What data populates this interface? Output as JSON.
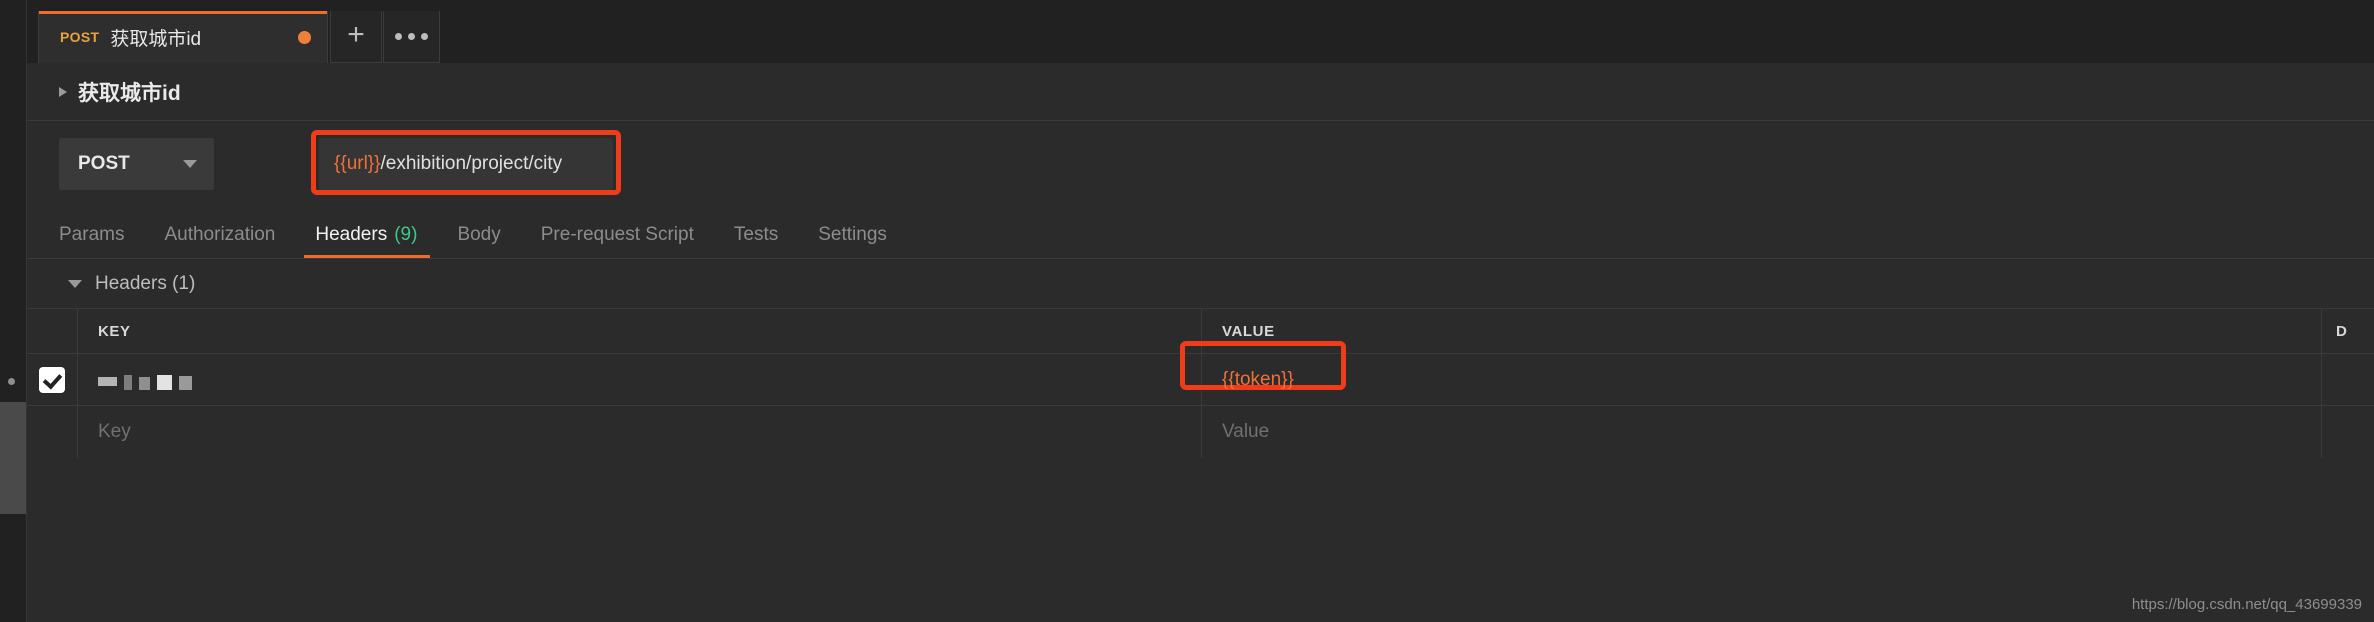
{
  "app": {
    "background": "#2b2b2b",
    "accent": "#ef6c2e",
    "annotation_color": "#f03c18",
    "variable_color": "#ef7138",
    "count_color": "#3ec98a"
  },
  "tabstrip": {
    "tabs": [
      {
        "method": "POST",
        "title": "获取城市id",
        "unsaved": true,
        "active": true
      }
    ],
    "new_tab_label": "+",
    "more_label": "•••"
  },
  "breadcrumb": {
    "caret": "caret-right-icon",
    "title": "获取城市id"
  },
  "request": {
    "method": "POST",
    "method_caret": "chevron-down-icon",
    "url_variable": "{{url}}",
    "url_path": "/exhibition/project/city",
    "url_full": "{{url}}/exhibition/project/city"
  },
  "request_tabs": [
    {
      "label": "Params",
      "active": false,
      "count": ""
    },
    {
      "label": "Authorization",
      "active": false,
      "count": ""
    },
    {
      "label": "Headers",
      "active": true,
      "count": "(9)"
    },
    {
      "label": "Body",
      "active": false,
      "count": ""
    },
    {
      "label": "Pre-request Script",
      "active": false,
      "count": ""
    },
    {
      "label": "Tests",
      "active": false,
      "count": ""
    },
    {
      "label": "Settings",
      "active": false,
      "count": ""
    }
  ],
  "headers_section": {
    "caret": "caret-down-icon",
    "label": "Headers (1)"
  },
  "table": {
    "columns": {
      "key": "KEY",
      "value": "VALUE",
      "description": "D"
    },
    "rows": [
      {
        "checked": true,
        "key": "",
        "key_redacted": true,
        "value": "{{token}}",
        "value_highlighted": true
      }
    ],
    "blank_row": {
      "key_placeholder": "Key",
      "value_placeholder": "Value"
    }
  },
  "watermark": "https://blog.csdn.net/qq_43699339"
}
